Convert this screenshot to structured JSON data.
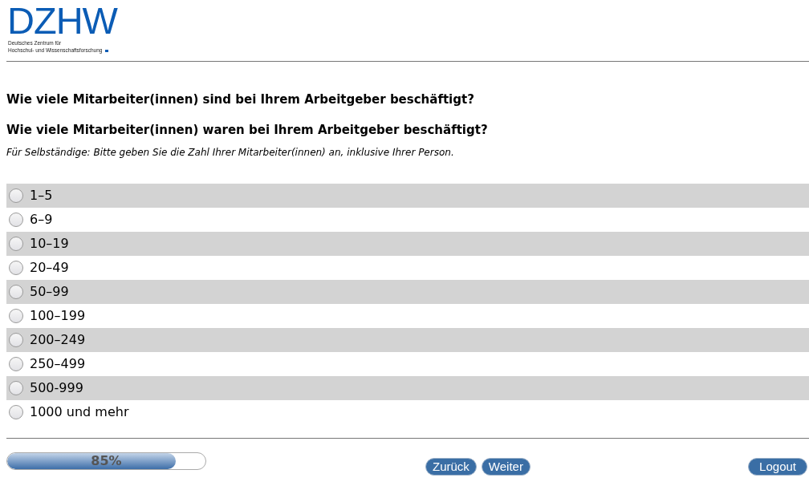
{
  "logo": {
    "letters": "DZHW",
    "subtitle_lines": [
      "Deutsches Zentrum für",
      "Hochschul- und Wissenschaftsforschung"
    ]
  },
  "questions": [
    "Wie viele Mitarbeiter(innen) sind bei Ihrem Arbeitgeber beschäftigt?",
    "Wie viele Mitarbeiter(innen) waren bei Ihrem Arbeitgeber beschäftigt?"
  ],
  "hint": "Für Selbständige: Bitte geben Sie die Zahl Ihrer Mitarbeiter(innen) an, inklusive Ihrer Person.",
  "options": [
    {
      "label": "1–5",
      "selected": false
    },
    {
      "label": "6–9",
      "selected": false
    },
    {
      "label": "10–19",
      "selected": false
    },
    {
      "label": "20–49",
      "selected": false
    },
    {
      "label": "50–99",
      "selected": false
    },
    {
      "label": "100–199",
      "selected": false
    },
    {
      "label": "200–249",
      "selected": false
    },
    {
      "label": "250–499",
      "selected": false
    },
    {
      "label": "500-999",
      "selected": false
    },
    {
      "label": "1000 und mehr",
      "selected": false
    }
  ],
  "progress": {
    "level": 0.85,
    "label": "85%"
  },
  "nav_buttons": [
    {
      "label": "Zurück"
    },
    {
      "label": "Weiter"
    }
  ],
  "logout_button": {
    "label": "Logout"
  }
}
